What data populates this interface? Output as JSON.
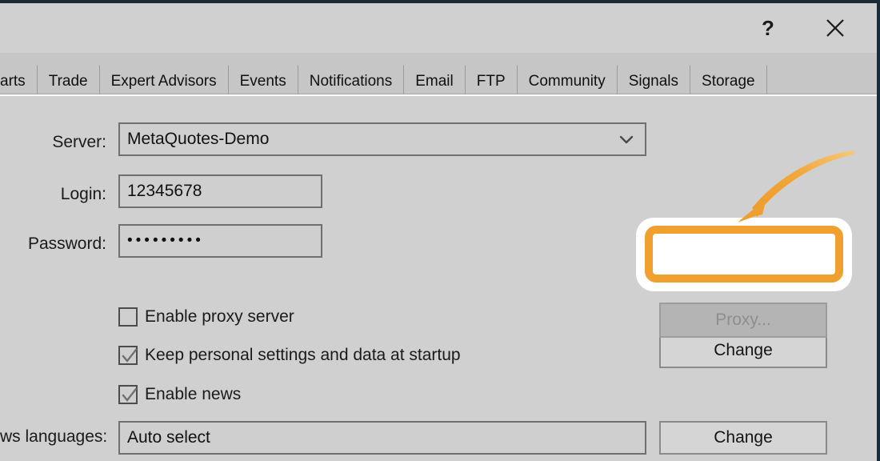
{
  "window": {
    "help_button": "?",
    "close_button": "close-icon",
    "frame_color": "#1d2b36",
    "surface_color": "#d0d0d0"
  },
  "tabs": {
    "items": [
      {
        "label": "arts",
        "clipped": true
      },
      {
        "label": "Trade",
        "clipped": false
      },
      {
        "label": "Expert Advisors",
        "clipped": false
      },
      {
        "label": "Events",
        "clipped": false
      },
      {
        "label": "Notifications",
        "clipped": false
      },
      {
        "label": "Email",
        "clipped": false
      },
      {
        "label": "FTP",
        "clipped": false
      },
      {
        "label": "Community",
        "clipped": false
      },
      {
        "label": "Signals",
        "clipped": false
      },
      {
        "label": "Storage",
        "clipped": false
      }
    ]
  },
  "form": {
    "server": {
      "label": "Server:",
      "value": "MetaQuotes-Demo",
      "icon": "chevron-down-icon"
    },
    "login": {
      "label": "Login:",
      "value": "12345678"
    },
    "password": {
      "label": "Password:",
      "value": "•••••••••",
      "masked_char_count": 9
    },
    "change_password_button": {
      "label": "Change",
      "enabled": true,
      "highlighted": true
    },
    "proxy_button": {
      "label": "Proxy...",
      "enabled": false
    },
    "checkboxes": [
      {
        "label": "Enable proxy server",
        "checked": false
      },
      {
        "label": "Keep personal settings and data at startup",
        "checked": true
      },
      {
        "label": "Enable news",
        "checked": true
      }
    ],
    "news_languages": {
      "label": "ws languages:",
      "value": "Auto select"
    },
    "change_languages_button": {
      "label": "Change",
      "enabled": true
    }
  },
  "annotation": {
    "highlight_color": "#f0a02e",
    "halo_color": "#ffffff",
    "arrow_color": "#f0a02e",
    "arrow_target": "change-password-button"
  }
}
